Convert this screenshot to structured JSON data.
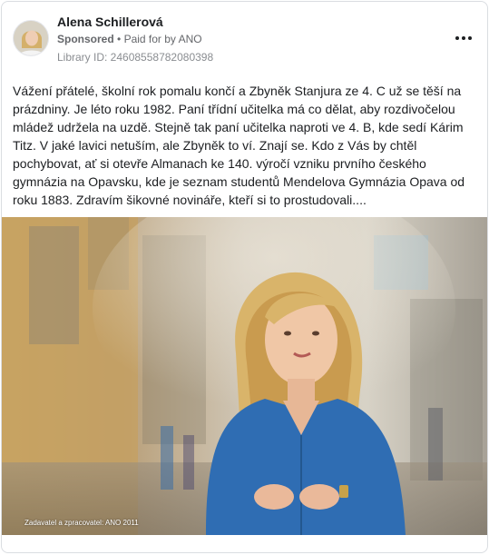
{
  "post": {
    "author": "Alena Schillerová",
    "sponsored_label": "Sponsored",
    "separator": "•",
    "paid_for": "Paid for by ANO",
    "library_id": "Library ID: 24608558782080398",
    "body": "Vážení přátelé, školní rok pomalu končí a Zbyněk Stanjura ze 4. C už se těší na prázdniny. Je léto roku 1982. Paní třídní učitelka má co dělat, aby rozdivočelou mládež udržela na uzdě. Stejně tak paní učitelka naproti ve 4. B, kde sedí Kárim Titz. V jaké lavici netuším, ale Zbyněk to ví. Znají se. Kdo z Vás by chtěl pochybovat, ať si otevře Almanach ke 140. výročí vzniku prvního českého gymnázia na Opavsku, kde je seznam studentů Mendelova Gymnázia Opava od roku 1883. Zdravím šikovné novináře, kteří si to prostudovali....",
    "image_caption": "Zadavatel a zpracovatel: ANO 2011"
  },
  "icons": {
    "menu": "more-horizontal-icon",
    "avatar": "profile-photo"
  },
  "colors": {
    "text_primary": "#1c1e21",
    "text_secondary": "#65676b",
    "border": "#dadde1",
    "blouse": "#2f6db3"
  }
}
